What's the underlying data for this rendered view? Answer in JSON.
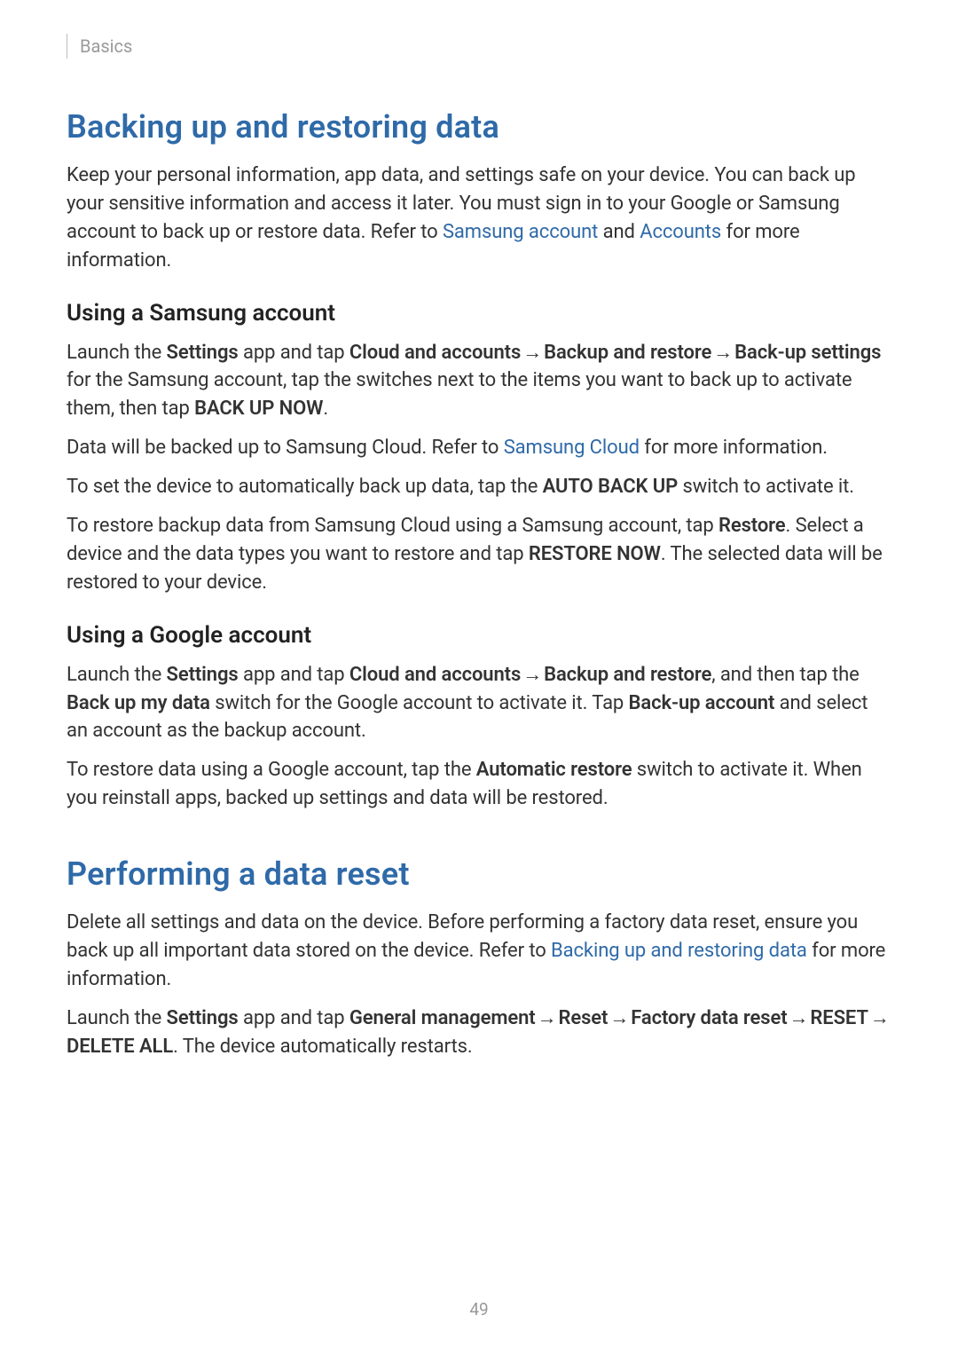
{
  "breadcrumb": "Basics",
  "section1": {
    "title": "Backing up and restoring data",
    "intro_part1": "Keep your personal information, app data, and settings safe on your device. You can back up your sensitive information and access it later. You must sign in to your Google or Samsung account to back up or restore data. Refer to ",
    "link1": "Samsung account",
    "intro_part2": " and ",
    "link2": "Accounts",
    "intro_part3": " for more information.",
    "sub1": {
      "title": "Using a Samsung account",
      "p1_a": "Launch the ",
      "p1_b": "Settings",
      "p1_c": " app and tap ",
      "p1_d": "Cloud and accounts",
      "arrow": " → ",
      "p1_e": "Backup and restore",
      "p1_f": "Back-up settings",
      "p1_g": " for the Samsung account, tap the switches next to the items you want to back up to activate them, then tap ",
      "p1_h": "BACK UP NOW",
      "p1_i": ".",
      "p2_a": "Data will be backed up to Samsung Cloud. Refer to ",
      "p2_link": "Samsung Cloud",
      "p2_b": " for more information.",
      "p3_a": "To set the device to automatically back up data, tap the ",
      "p3_b": "AUTO BACK UP",
      "p3_c": " switch to activate it.",
      "p4_a": "To restore backup data from Samsung Cloud using a Samsung account, tap ",
      "p4_b": "Restore",
      "p4_c": ". Select a device and the data types you want to restore and tap ",
      "p4_d": "RESTORE NOW",
      "p4_e": ". The selected data will be restored to your device."
    },
    "sub2": {
      "title": "Using a Google account",
      "p1_a": "Launch the ",
      "p1_b": "Settings",
      "p1_c": " app and tap ",
      "p1_d": "Cloud and accounts",
      "arrow": " → ",
      "p1_e": "Backup and restore",
      "p1_f": ", and then tap the ",
      "p1_g": "Back up my data",
      "p1_h": " switch for the Google account to activate it. Tap ",
      "p1_i": "Back-up account",
      "p1_j": " and select an account as the backup account.",
      "p2_a": "To restore data using a Google account, tap the ",
      "p2_b": "Automatic restore",
      "p2_c": " switch to activate it. When you reinstall apps, backed up settings and data will be restored."
    }
  },
  "section2": {
    "title": "Performing a data reset",
    "p1_a": "Delete all settings and data on the device. Before performing a factory data reset, ensure you back up all important data stored on the device. Refer to ",
    "p1_link": "Backing up and restoring data",
    "p1_b": " for more information.",
    "p2_a": "Launch the ",
    "p2_b": "Settings",
    "p2_c": " app and tap ",
    "p2_d": "General management",
    "arrow": " → ",
    "p2_e": "Reset",
    "p2_f": "Factory data reset",
    "p2_g": "RESET",
    "p2_h": "DELETE ALL",
    "p2_i": ". The device automatically restarts."
  },
  "page_number": "49"
}
